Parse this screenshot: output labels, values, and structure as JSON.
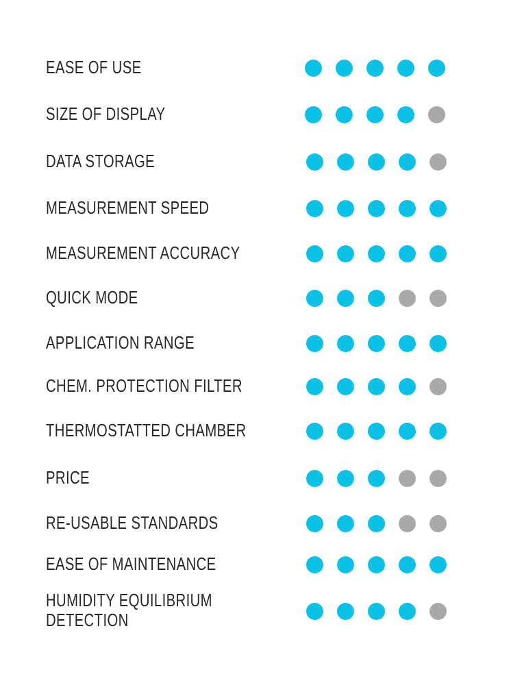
{
  "colors": {
    "filled": "#0bc1e5",
    "empty": "#a9a9a9"
  },
  "chart_data": {
    "type": "table",
    "title": "",
    "max_rating": 5,
    "categories": [
      "EASE OF USE",
      "SIZE OF DISPLAY",
      "DATA STORAGE",
      "MEASUREMENT SPEED",
      "MEASUREMENT ACCURACY",
      "QUICK MODE",
      "APPLICATION RANGE",
      "CHEM. PROTECTION FILTER",
      "THERMOSTATTED CHAMBER",
      "PRICE",
      "RE-USABLE STANDARDS",
      "EASE OF MAINTENANCE",
      "HUMIDITY EQUILIBRIUM DETECTION"
    ],
    "label_lines": [
      [
        "EASE OF USE"
      ],
      [
        "SIZE OF DISPLAY"
      ],
      [
        "DATA STORAGE"
      ],
      [
        "MEASUREMENT SPEED"
      ],
      [
        "MEASUREMENT ACCURACY"
      ],
      [
        "QUICK MODE"
      ],
      [
        "APPLICATION RANGE"
      ],
      [
        "CHEM. PROTECTION FILTER"
      ],
      [
        "THERMOSTATTED CHAMBER"
      ],
      [
        "PRICE"
      ],
      [
        "RE-USABLE STANDARDS"
      ],
      [
        "EASE OF MAINTENANCE"
      ],
      [
        "HUMIDITY EQUILIBRIUM",
        "DETECTION"
      ]
    ],
    "values": [
      5,
      4,
      4,
      5,
      5,
      3,
      5,
      4,
      5,
      3,
      3,
      5,
      4
    ]
  }
}
